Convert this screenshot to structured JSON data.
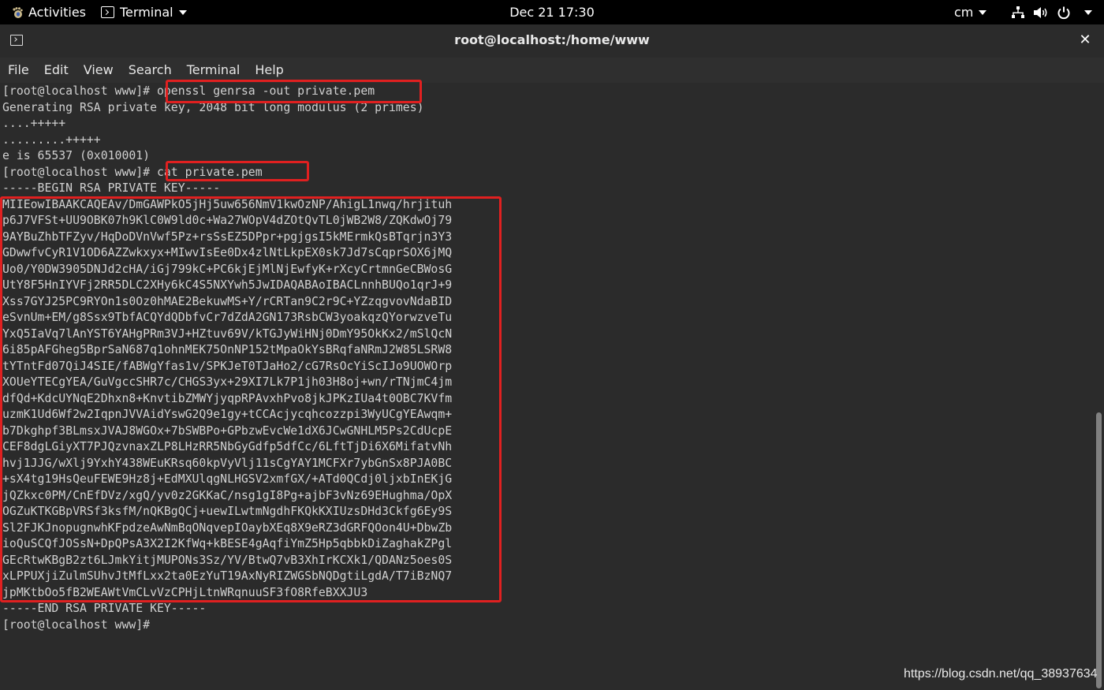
{
  "topbar": {
    "activities_label": "Activities",
    "app_menu_label": "Terminal",
    "clock": "Dec 21  17:30",
    "user_label": "cm"
  },
  "window": {
    "title": "root@localhost:/home/www",
    "close_symbol": "✕"
  },
  "menubar": {
    "items": [
      "File",
      "Edit",
      "View",
      "Search",
      "Terminal",
      "Help"
    ]
  },
  "terminal": {
    "lines": [
      "[root@localhost www]# openssl genrsa -out private.pem",
      "Generating RSA private key, 2048 bit long modulus (2 primes)",
      "....+++++",
      ".........+++++",
      "e is 65537 (0x010001)",
      "[root@localhost www]# cat private.pem",
      "-----BEGIN RSA PRIVATE KEY-----",
      "MIIEowIBAAKCAQEAv/DmGAWPkO5jHj5uw656NmV1kwOzNP/AhigL1nwq/hrjituh",
      "p6J7VFSt+UU9OBK07h9KlC0W9ld0c+Wa27WOpV4dZOtQvTL0jWB2W8/ZQKdwOj79",
      "9AYBuZhbTFZyv/HqDoDVnVwf5Pz+rsSsEZ5DPpr+pgjgsI5kMErmkQsBTqrjn3Y3",
      "GDwwfvCyR1V1OD6AZZwkxyx+MIwvIsEe0Dx4zlNtLkpEX0sk7Jd7sCqprSOX6jMQ",
      "Uo0/Y0DW3905DNJd2cHA/iGj799kC+PC6kjEjMlNjEwfyK+rXcyCrtmnGeCBWosG",
      "UtY8F5HnIYVFj2RR5DLC2XHy6kC4S5NXYwh5JwIDAQABAoIBACLnnhBUQo1qrJ+9",
      "Xss7GYJ25PC9RYOn1s0Oz0hMAE2BekuwMS+Y/rCRTan9C2r9C+YZzqgvovNdaBID",
      "eSvnUm+EM/g8Ssx9TbfACQYdQDbfvCr7dZdA2GN173RsbCW3yoakqzQYorwzveTu",
      "YxQ5IaVq7lAnYST6YAHgPRm3VJ+HZtuv69V/kTGJyWiHNj0DmY95OkKx2/mSlQcN",
      "6i85pAFGheg5BprSaN687q1ohnMEK75OnNP152tMpaOkYsBRqfaNRmJ2W85LSRW8",
      "tYTntFd07QiJ4SIE/fABWgYfas1v/SPKJeT0TJaHo2/cG7RsOcYiScIJo9UOWOrp",
      "XOUeYTECgYEA/GuVgccSHR7c/CHGS3yx+29XI7Lk7P1jh03H8oj+wn/rTNjmC4jm",
      "dfQd+KdcUYNqE2Dhxn8+KnvtibZMWYjyqpRPAvxhPvo8jkJPKzIUa4t0OBC7KVfm",
      "uzmK1Ud6Wf2w2IqpnJVVAidYswG2Q9e1gy+tCCAcjycqhcozzpi3WyUCgYEAwqm+",
      "b7Dkghpf3BLmsxJVAJ8WGOx+7bSWBPo+GPbzwEvcWe1dX6JCwGNHLM5Ps2CdUcpE",
      "CEF8dgLGiyXT7PJQzvnaxZLP8LHzRR5NbGyGdfp5dfCc/6LftTjDi6X6MifatvNh",
      "hvj1JJG/wXlj9YxhY438WEuKRsq60kpVyVlj11sCgYAY1MCFXr7ybGnSx8PJA0BC",
      "+sX4tg19HsQeuFEWE9Hz8j+EdMXUlqgNLHGSV2xmfGX/+ATd0QCdj0ljxbInEKjG",
      "jQZkxc0PM/CnEfDVz/xgQ/yv0z2GKKaC/nsg1gI8Pg+ajbF3vNz69EHughma/OpX",
      "OGZuKTKGBpVRSf3ksfM/nQKBgQCj+uewILwtmNgdhFKQkKXIUzsDHd3Ckfg6Ey9S",
      "Sl2FJKJnopugnwhKFpdzeAwNmBqONqvepIOaybXEq8X9eRZ3dGRFQOon4U+DbwZb",
      "ioQuSCQfJOSsN+DpQPsA3X2I2KfWq+kBESE4gAqfiYmZ5Hp5qbbkDiZaghakZPgl",
      "GEcRtwKBgB2zt6LJmkYitjMUPONs3Sz/YV/BtwQ7vB3XhIrKCXk1/QDANz5oes0S",
      "xLPPUXjiZulmSUhvJtMfLxx2ta0EzYuT19AxNyRIZWGSbNQDgtiLgdA/T7iBzNQ7",
      "jpMKtbOo5fB2WEAWtVmCLvVzCPHjLtnWRqnuuSF3fO8RfeBXXJU3",
      "-----END RSA PRIVATE KEY-----",
      "[root@localhost www]#"
    ]
  },
  "watermark": "https://blog.csdn.net/qq_38937634",
  "colors": {
    "highlight": "#e02020",
    "terminal_bg": "#2b2b2b",
    "terminal_fg": "#d0d0d0"
  }
}
